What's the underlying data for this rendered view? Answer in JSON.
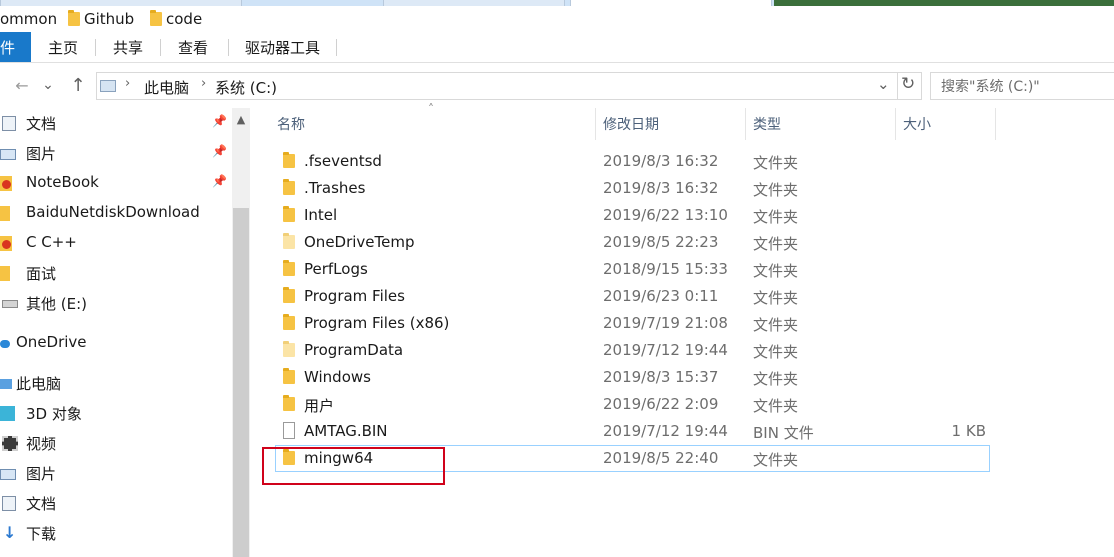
{
  "quickbar": {
    "items": [
      "ommon",
      "Github",
      "code"
    ]
  },
  "ribbon": {
    "file_label": "件",
    "tabs": [
      "主页",
      "共享",
      "查看",
      "驱动器工具"
    ]
  },
  "address": {
    "back": "←",
    "forward": "→",
    "recent": "⌄",
    "up": "↑",
    "path": [
      "此电脑",
      "系统 (C:)"
    ],
    "dropdown": "⌄",
    "refresh": "↻"
  },
  "search": {
    "placeholder": "搜索\"系统 (C:)\""
  },
  "sidebar": {
    "items": [
      {
        "label": "文档",
        "icon": "document-icon",
        "pinned": true
      },
      {
        "label": "图片",
        "icon": "pictures-icon",
        "pinned": true
      },
      {
        "label": "NoteBook",
        "icon": "warning-folder-icon",
        "pinned": true
      },
      {
        "label": "BaiduNetdiskDownload",
        "icon": "folder-icon",
        "pinned": false
      },
      {
        "label": "C C++",
        "icon": "warning-folder-icon",
        "pinned": false
      },
      {
        "label": "面试",
        "icon": "folder-icon",
        "pinned": false
      },
      {
        "label": "其他 (E:)",
        "icon": "drive-icon",
        "pinned": false
      },
      {
        "label": "OneDrive",
        "icon": "cloud-icon",
        "pinned": false
      },
      {
        "label": "此电脑",
        "icon": "computer-icon",
        "pinned": false
      },
      {
        "label": "3D 对象",
        "icon": "cube-icon",
        "pinned": false
      },
      {
        "label": "视频",
        "icon": "video-icon",
        "pinned": false
      },
      {
        "label": "图片",
        "icon": "pictures-icon",
        "pinned": false
      },
      {
        "label": "文档",
        "icon": "document-icon",
        "pinned": false
      },
      {
        "label": "下载",
        "icon": "download-icon",
        "pinned": false
      }
    ]
  },
  "columns": {
    "name": "名称",
    "date": "修改日期",
    "type": "类型",
    "size": "大小"
  },
  "files": [
    {
      "name": ".fseventsd",
      "date": "2019/8/3 16:32",
      "type": "文件夹",
      "size": "",
      "kind": "folder"
    },
    {
      "name": ".Trashes",
      "date": "2019/8/3 16:32",
      "type": "文件夹",
      "size": "",
      "kind": "folder"
    },
    {
      "name": "Intel",
      "date": "2019/6/22 13:10",
      "type": "文件夹",
      "size": "",
      "kind": "folder"
    },
    {
      "name": "OneDriveTemp",
      "date": "2019/8/5 22:23",
      "type": "文件夹",
      "size": "",
      "kind": "folder-pale"
    },
    {
      "name": "PerfLogs",
      "date": "2018/9/15 15:33",
      "type": "文件夹",
      "size": "",
      "kind": "folder"
    },
    {
      "name": "Program Files",
      "date": "2019/6/23 0:11",
      "type": "文件夹",
      "size": "",
      "kind": "folder"
    },
    {
      "name": "Program Files (x86)",
      "date": "2019/7/19 21:08",
      "type": "文件夹",
      "size": "",
      "kind": "folder"
    },
    {
      "name": "ProgramData",
      "date": "2019/7/12 19:44",
      "type": "文件夹",
      "size": "",
      "kind": "folder-pale"
    },
    {
      "name": "Windows",
      "date": "2019/8/3 15:37",
      "type": "文件夹",
      "size": "",
      "kind": "folder"
    },
    {
      "name": "用户",
      "date": "2019/6/22 2:09",
      "type": "文件夹",
      "size": "",
      "kind": "folder"
    },
    {
      "name": "AMTAG.BIN",
      "date": "2019/7/12 19:44",
      "type": "BIN 文件",
      "size": "1 KB",
      "kind": "file"
    },
    {
      "name": "mingw64",
      "date": "2019/8/5 22:40",
      "type": "文件夹",
      "size": "",
      "kind": "folder",
      "selected": true
    }
  ],
  "colors": {
    "accent": "#1979ca",
    "selection_border": "#99d1ff",
    "highlight": "#d0021b",
    "folder": "#f6c343"
  }
}
